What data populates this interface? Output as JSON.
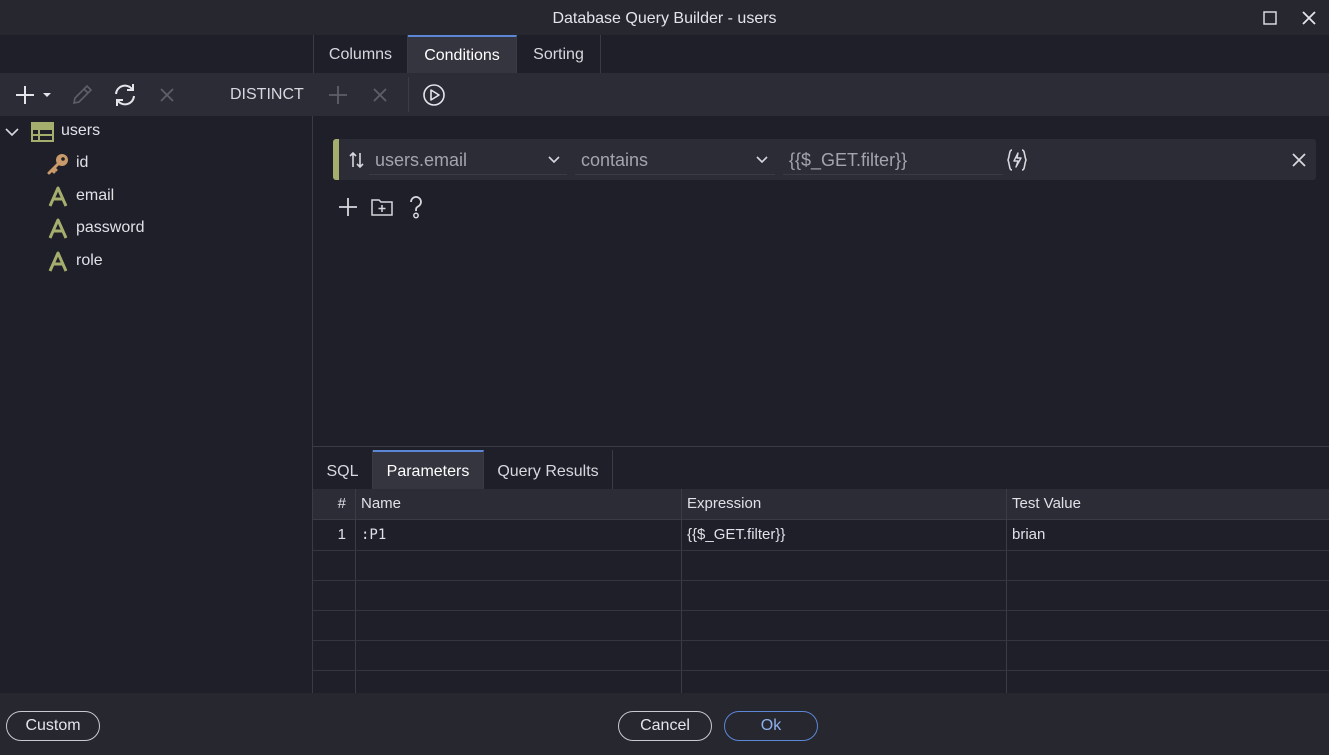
{
  "window": {
    "title": "Database Query Builder - users"
  },
  "top_tabs": [
    {
      "label": "Columns",
      "active": false
    },
    {
      "label": "Conditions",
      "active": true
    },
    {
      "label": "Sorting",
      "active": false
    }
  ],
  "toolbar": {
    "distinct_label": "DISTINCT"
  },
  "tree": {
    "table": "users",
    "columns": [
      {
        "name": "id",
        "icon": "key-icon"
      },
      {
        "name": "email",
        "icon": "text-type-icon"
      },
      {
        "name": "password",
        "icon": "text-type-icon"
      },
      {
        "name": "role",
        "icon": "text-type-icon"
      }
    ]
  },
  "condition": {
    "column": "users.email",
    "operator": "contains",
    "value": "{{$_GET.filter}}"
  },
  "bottom_tabs": [
    {
      "label": "SQL",
      "active": false
    },
    {
      "label": "Parameters",
      "active": true
    },
    {
      "label": "Query Results",
      "active": false
    }
  ],
  "params_table": {
    "headers": [
      "#",
      "Name",
      "Expression",
      "Test Value"
    ],
    "rows": [
      {
        "index": "1",
        "name": ":P1",
        "expression": "{{$_GET.filter}}",
        "test_value": "brian"
      }
    ]
  },
  "footer": {
    "custom_label": "Custom",
    "cancel_label": "Cancel",
    "ok_label": "Ok"
  },
  "colors": {
    "accent": "#5c86d6",
    "condition_marker": "#a5ae6c",
    "column_icon": "#a5ae6c",
    "key_icon": "#c99a6a"
  }
}
